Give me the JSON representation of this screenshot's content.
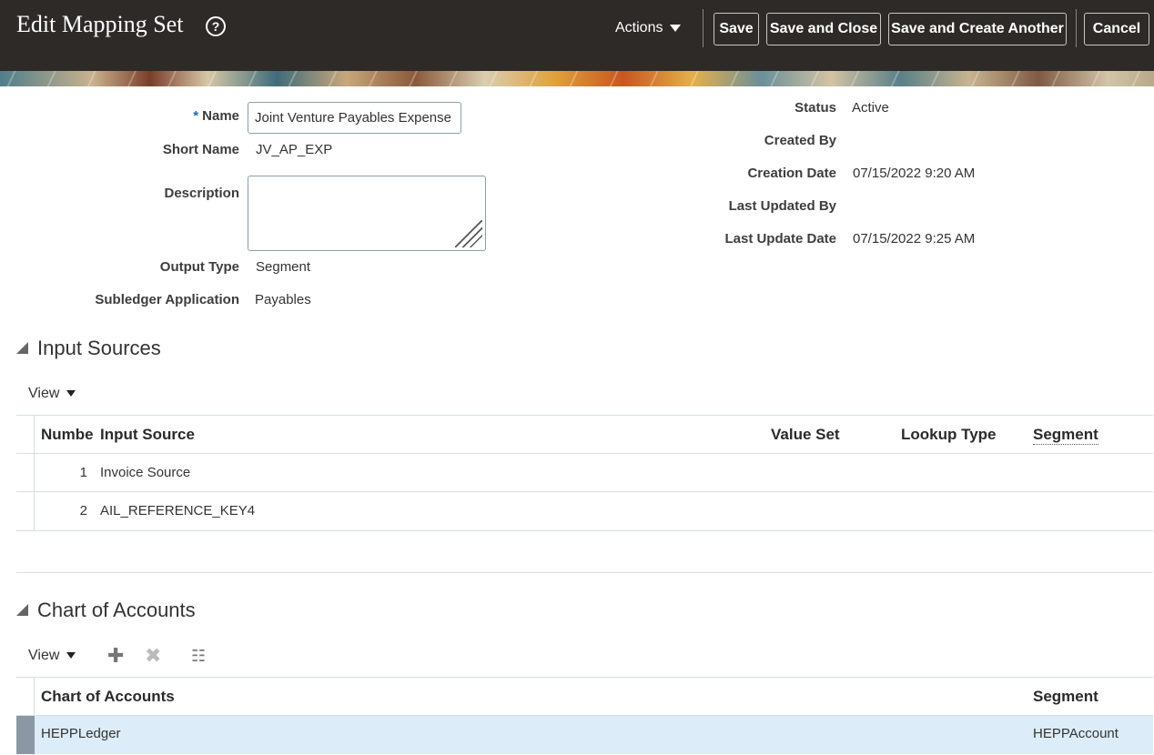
{
  "header": {
    "title": "Edit Mapping Set",
    "help_icon": "?",
    "actions_label": "Actions",
    "buttons": {
      "save": "Save",
      "save_close": "Save and Close",
      "save_create": "Save and Create Another",
      "cancel": "Cancel"
    }
  },
  "form": {
    "name_label": "Name",
    "required_marker": "*",
    "name_value": "Joint Venture Payables Expense",
    "short_name_label": "Short Name",
    "short_name_value": "JV_AP_EXP",
    "description_label": "Description",
    "description_value": "",
    "output_type_label": "Output Type",
    "output_type_value": "Segment",
    "subledger_label": "Subledger Application",
    "subledger_value": "Payables",
    "status_label": "Status",
    "status_value": "Active",
    "created_by_label": "Created By",
    "created_by_value": "",
    "creation_date_label": "Creation Date",
    "creation_date_value": "07/15/2022 9:20 AM",
    "last_updated_by_label": "Last Updated By",
    "last_updated_by_value": "",
    "last_update_date_label": "Last Update Date",
    "last_update_date_value": "07/15/2022 9:25 AM"
  },
  "input_sources": {
    "title": "Input Sources",
    "view_label": "View",
    "columns": [
      "Numbe",
      "Input Source",
      "Value Set",
      "Lookup Type",
      "Segment"
    ],
    "rows": [
      {
        "number": "1",
        "input_source": "Invoice Source"
      },
      {
        "number": "2",
        "input_source": "AIL_REFERENCE_KEY4"
      }
    ]
  },
  "chart_of_accounts": {
    "title": "Chart of Accounts",
    "view_label": "View",
    "icons": [
      "add-icon",
      "delete-icon",
      "freeze-icon"
    ],
    "columns": [
      "Chart of Accounts",
      "Segment"
    ],
    "rows": [
      {
        "chart": "HEPPLedger",
        "segment": "HEPPAccount"
      }
    ]
  },
  "colors": {
    "header_bg": "#2d2a28",
    "selected_row": "#dcecf8",
    "required_marker": "#1c6cb8"
  }
}
